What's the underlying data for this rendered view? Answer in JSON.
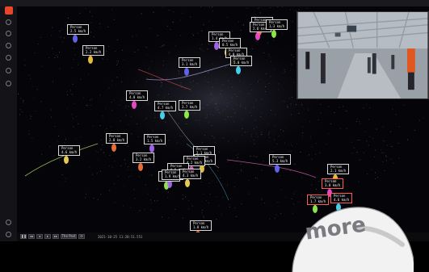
{
  "sidebar": {
    "logo": "app-logo",
    "icons": [
      "gear-icon",
      "nodes-icon",
      "layers-icon",
      "wifi-icon",
      "record-icon",
      "menu-icon"
    ],
    "bottom_icons": [
      "info-icon",
      "settings-icon"
    ]
  },
  "tracks": [
    {
      "name": "Person",
      "speed": "2.5 km/h",
      "hl": false
    },
    {
      "name": "Person",
      "speed": "2.2 km/h",
      "hl": false
    },
    {
      "name": "Person",
      "speed": "4.0 km/h",
      "hl": false
    },
    {
      "name": "Person",
      "speed": "4.7 km/h",
      "hl": false
    },
    {
      "name": "Person",
      "speed": "3.7 km/h",
      "hl": false
    },
    {
      "name": "Person",
      "speed": "1.8 km/h",
      "hl": false
    },
    {
      "name": "Person",
      "speed": "1.4 km/h",
      "hl": false
    },
    {
      "name": "Person",
      "speed": "0.5 km/h",
      "hl": false
    },
    {
      "name": "Person",
      "speed": "3.1 km/h",
      "hl": false
    },
    {
      "name": "Person",
      "speed": "4.0 km/h",
      "hl": false
    },
    {
      "name": "Person",
      "speed": "2.6 km/h",
      "hl": false
    },
    {
      "name": "Person",
      "speed": "5.0 km/h",
      "hl": false
    },
    {
      "name": "Person",
      "speed": "1.3 km/h",
      "hl": false
    },
    {
      "name": "Person",
      "speed": "2.0 km/h",
      "hl": false
    },
    {
      "name": "Person",
      "speed": "1.5 km/h",
      "hl": false
    },
    {
      "name": "Person",
      "speed": "4.6 km/h",
      "hl": false
    },
    {
      "name": "Person",
      "speed": "2.1 km/h",
      "hl": false
    },
    {
      "name": "Person",
      "speed": "3.7 km/h",
      "hl": false
    },
    {
      "name": "Person",
      "speed": "4.2 km/h",
      "hl": false
    },
    {
      "name": "Person",
      "speed": "0.5 km/h",
      "hl": false
    },
    {
      "name": "Person",
      "speed": "3.7 km/h",
      "hl": false
    },
    {
      "name": "Person",
      "speed": "3.2 km/h",
      "hl": false
    },
    {
      "name": "Person",
      "speed": "1.9 km/h",
      "hl": false
    },
    {
      "name": "Person",
      "speed": "4.3 km/h",
      "hl": false
    },
    {
      "name": "Person",
      "speed": "5.3 km/h",
      "hl": false
    },
    {
      "name": "Person",
      "speed": "2.1 km/h",
      "hl": false
    },
    {
      "name": "Person",
      "speed": "3.0 km/h",
      "hl": true
    },
    {
      "name": "Person",
      "speed": "4.6 km/h",
      "hl": true
    },
    {
      "name": "Person",
      "speed": "1.7 km/h",
      "hl": true
    },
    {
      "name": "Person",
      "speed": "1.8 km/h",
      "hl": false
    }
  ],
  "player": {
    "speed_label": "The Past",
    "timestamp": "2021-10-25 11:28:51.551"
  },
  "badge": {
    "text": "more"
  },
  "colors": {
    "accent": "#e8452a",
    "label_border": "#d9d9d9",
    "label_highlight": "#ff5a5a"
  }
}
